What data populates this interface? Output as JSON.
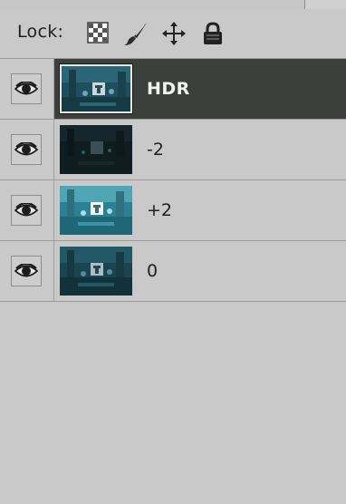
{
  "lock_bar": {
    "label": "Lock:",
    "icons": [
      "lock-transparent-pixels-icon",
      "lock-image-pixels-icon",
      "lock-position-icon",
      "lock-all-icon"
    ]
  },
  "layers": [
    {
      "name": "HDR",
      "selected": true,
      "visible": true,
      "thumb_tone": "bright"
    },
    {
      "name": "-2",
      "selected": false,
      "visible": true,
      "thumb_tone": "dark"
    },
    {
      "name": "+2",
      "selected": false,
      "visible": true,
      "thumb_tone": "bright"
    },
    {
      "name": "0",
      "selected": false,
      "visible": true,
      "thumb_tone": "medium"
    }
  ],
  "colors": {
    "panel_bg": "#c9c9c9",
    "selected_row_bg": "#3d3f3d",
    "selected_text": "#f2f2f2",
    "text": "#1f1f1f"
  }
}
